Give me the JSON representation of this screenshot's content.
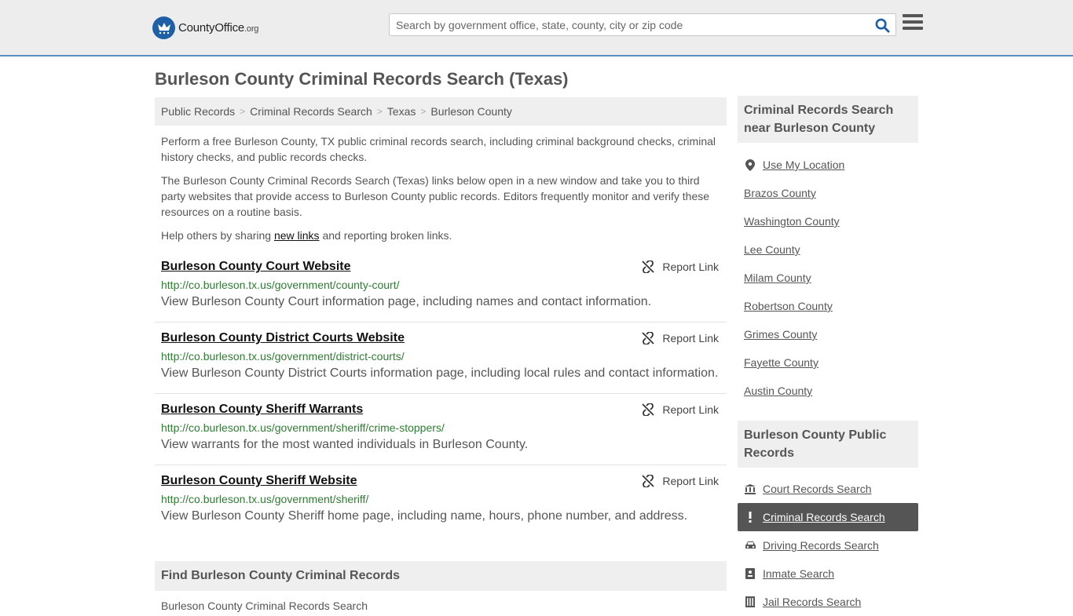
{
  "header": {
    "logo_main": "CountyOffice",
    "logo_suffix": ".org",
    "search_placeholder": "Search by government office, state, county, city or zip code"
  },
  "page_title": "Burleson County Criminal Records Search (Texas)",
  "breadcrumb": [
    "Public Records",
    "Criminal Records Search",
    "Texas",
    "Burleson County"
  ],
  "intro": {
    "p1": "Perform a free Burleson County, TX public criminal records search, including criminal background checks, criminal history checks, and public records checks.",
    "p2": "The Burleson County Criminal Records Search (Texas) links below open in a new window and take you to third party websites that provide access to Burleson County public records. Editors frequently monitor and verify these resources on a routine basis.",
    "p3_before": "Help others by sharing ",
    "p3_link": "new links",
    "p3_after": " and reporting broken links."
  },
  "report_label": "Report Link",
  "links": [
    {
      "title": "Burleson County Court Website",
      "url": "http://co.burleson.tx.us/government/county-court/",
      "desc": "View Burleson County Court information page, including names and contact information."
    },
    {
      "title": "Burleson County District Courts Website",
      "url": "http://co.burleson.tx.us/government/district-courts/",
      "desc": "View Burleson County District Courts information page, including local rules and contact information."
    },
    {
      "title": "Burleson County Sheriff Warrants",
      "url": "http://co.burleson.tx.us/government/sheriff/crime-stoppers/",
      "desc": "View warrants for the most wanted individuals in Burleson County."
    },
    {
      "title": "Burleson County Sheriff Website",
      "url": "http://co.burleson.tx.us/government/sheriff/",
      "desc": "View Burleson County Sheriff home page, including name, hours, phone number, and address."
    }
  ],
  "find_heading": "Find Burleson County Criminal Records",
  "find_text": "Burleson County Criminal Records Search",
  "sidebar": {
    "nearby_heading": "Criminal Records Search near Burleson County",
    "use_location": "Use My Location",
    "nearby": [
      "Brazos County",
      "Washington County",
      "Lee County",
      "Milam County",
      "Robertson County",
      "Grimes County",
      "Fayette County",
      "Austin County"
    ],
    "public_heading": "Burleson County Public Records",
    "public_records": [
      {
        "label": "Court Records Search",
        "icon": "courthouse-icon"
      },
      {
        "label": "Criminal Records Search",
        "icon": "exclamation-icon"
      },
      {
        "label": "Driving Records Search",
        "icon": "car-icon"
      },
      {
        "label": "Inmate Search",
        "icon": "id-badge-icon"
      },
      {
        "label": "Jail Records Search",
        "icon": "jail-icon"
      }
    ]
  },
  "colors": {
    "header_bg": "#ededed",
    "header_border": "#5a8ec6",
    "search_icon": "#1f5fa6",
    "url_green": "#2e7d32",
    "active_bg": "#555555"
  }
}
